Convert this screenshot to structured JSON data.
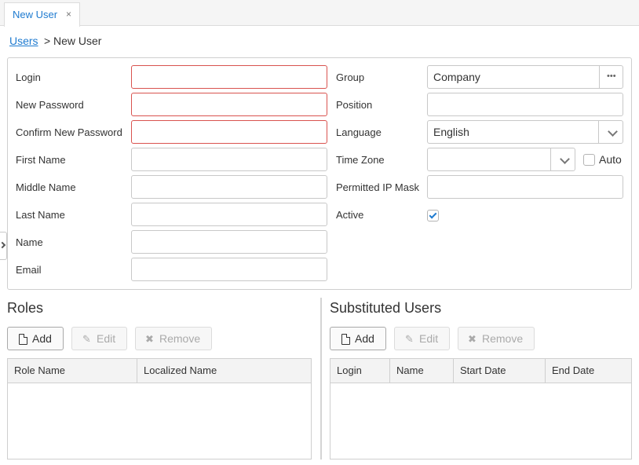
{
  "tabs": [
    {
      "label": "New User",
      "close": "×"
    }
  ],
  "breadcrumb": {
    "parent": "Users",
    "separator": ">",
    "current": "New User"
  },
  "form": {
    "left": [
      {
        "label": "Login",
        "value": "",
        "required": true
      },
      {
        "label": "New Password",
        "value": "",
        "required": true
      },
      {
        "label": "Confirm New Password",
        "value": "",
        "required": true
      },
      {
        "label": "First Name",
        "value": ""
      },
      {
        "label": "Middle Name",
        "value": ""
      },
      {
        "label": "Last Name",
        "value": ""
      },
      {
        "label": "Name",
        "value": ""
      },
      {
        "label": "Email",
        "value": ""
      }
    ],
    "group": {
      "label": "Group",
      "value": "Company",
      "picker_icon": "ellipsis-icon"
    },
    "position": {
      "label": "Position",
      "value": ""
    },
    "language": {
      "label": "Language",
      "value": "English"
    },
    "time_zone": {
      "label": "Time Zone",
      "value": "",
      "auto_label": "Auto",
      "auto_checked": false
    },
    "ip_mask": {
      "label": "Permitted IP Mask",
      "value": ""
    },
    "active": {
      "label": "Active",
      "checked": true
    }
  },
  "roles": {
    "title": "Roles",
    "buttons": {
      "add": "Add",
      "edit": "Edit",
      "remove": "Remove"
    },
    "columns": [
      "Role Name",
      "Localized Name"
    ]
  },
  "substituted": {
    "title": "Substituted Users",
    "buttons": {
      "add": "Add",
      "edit": "Edit",
      "remove": "Remove"
    },
    "columns": [
      "Login",
      "Name",
      "Start Date",
      "End Date"
    ]
  },
  "colors": {
    "accent": "#1f7bd0",
    "required_border": "#d9534f"
  }
}
